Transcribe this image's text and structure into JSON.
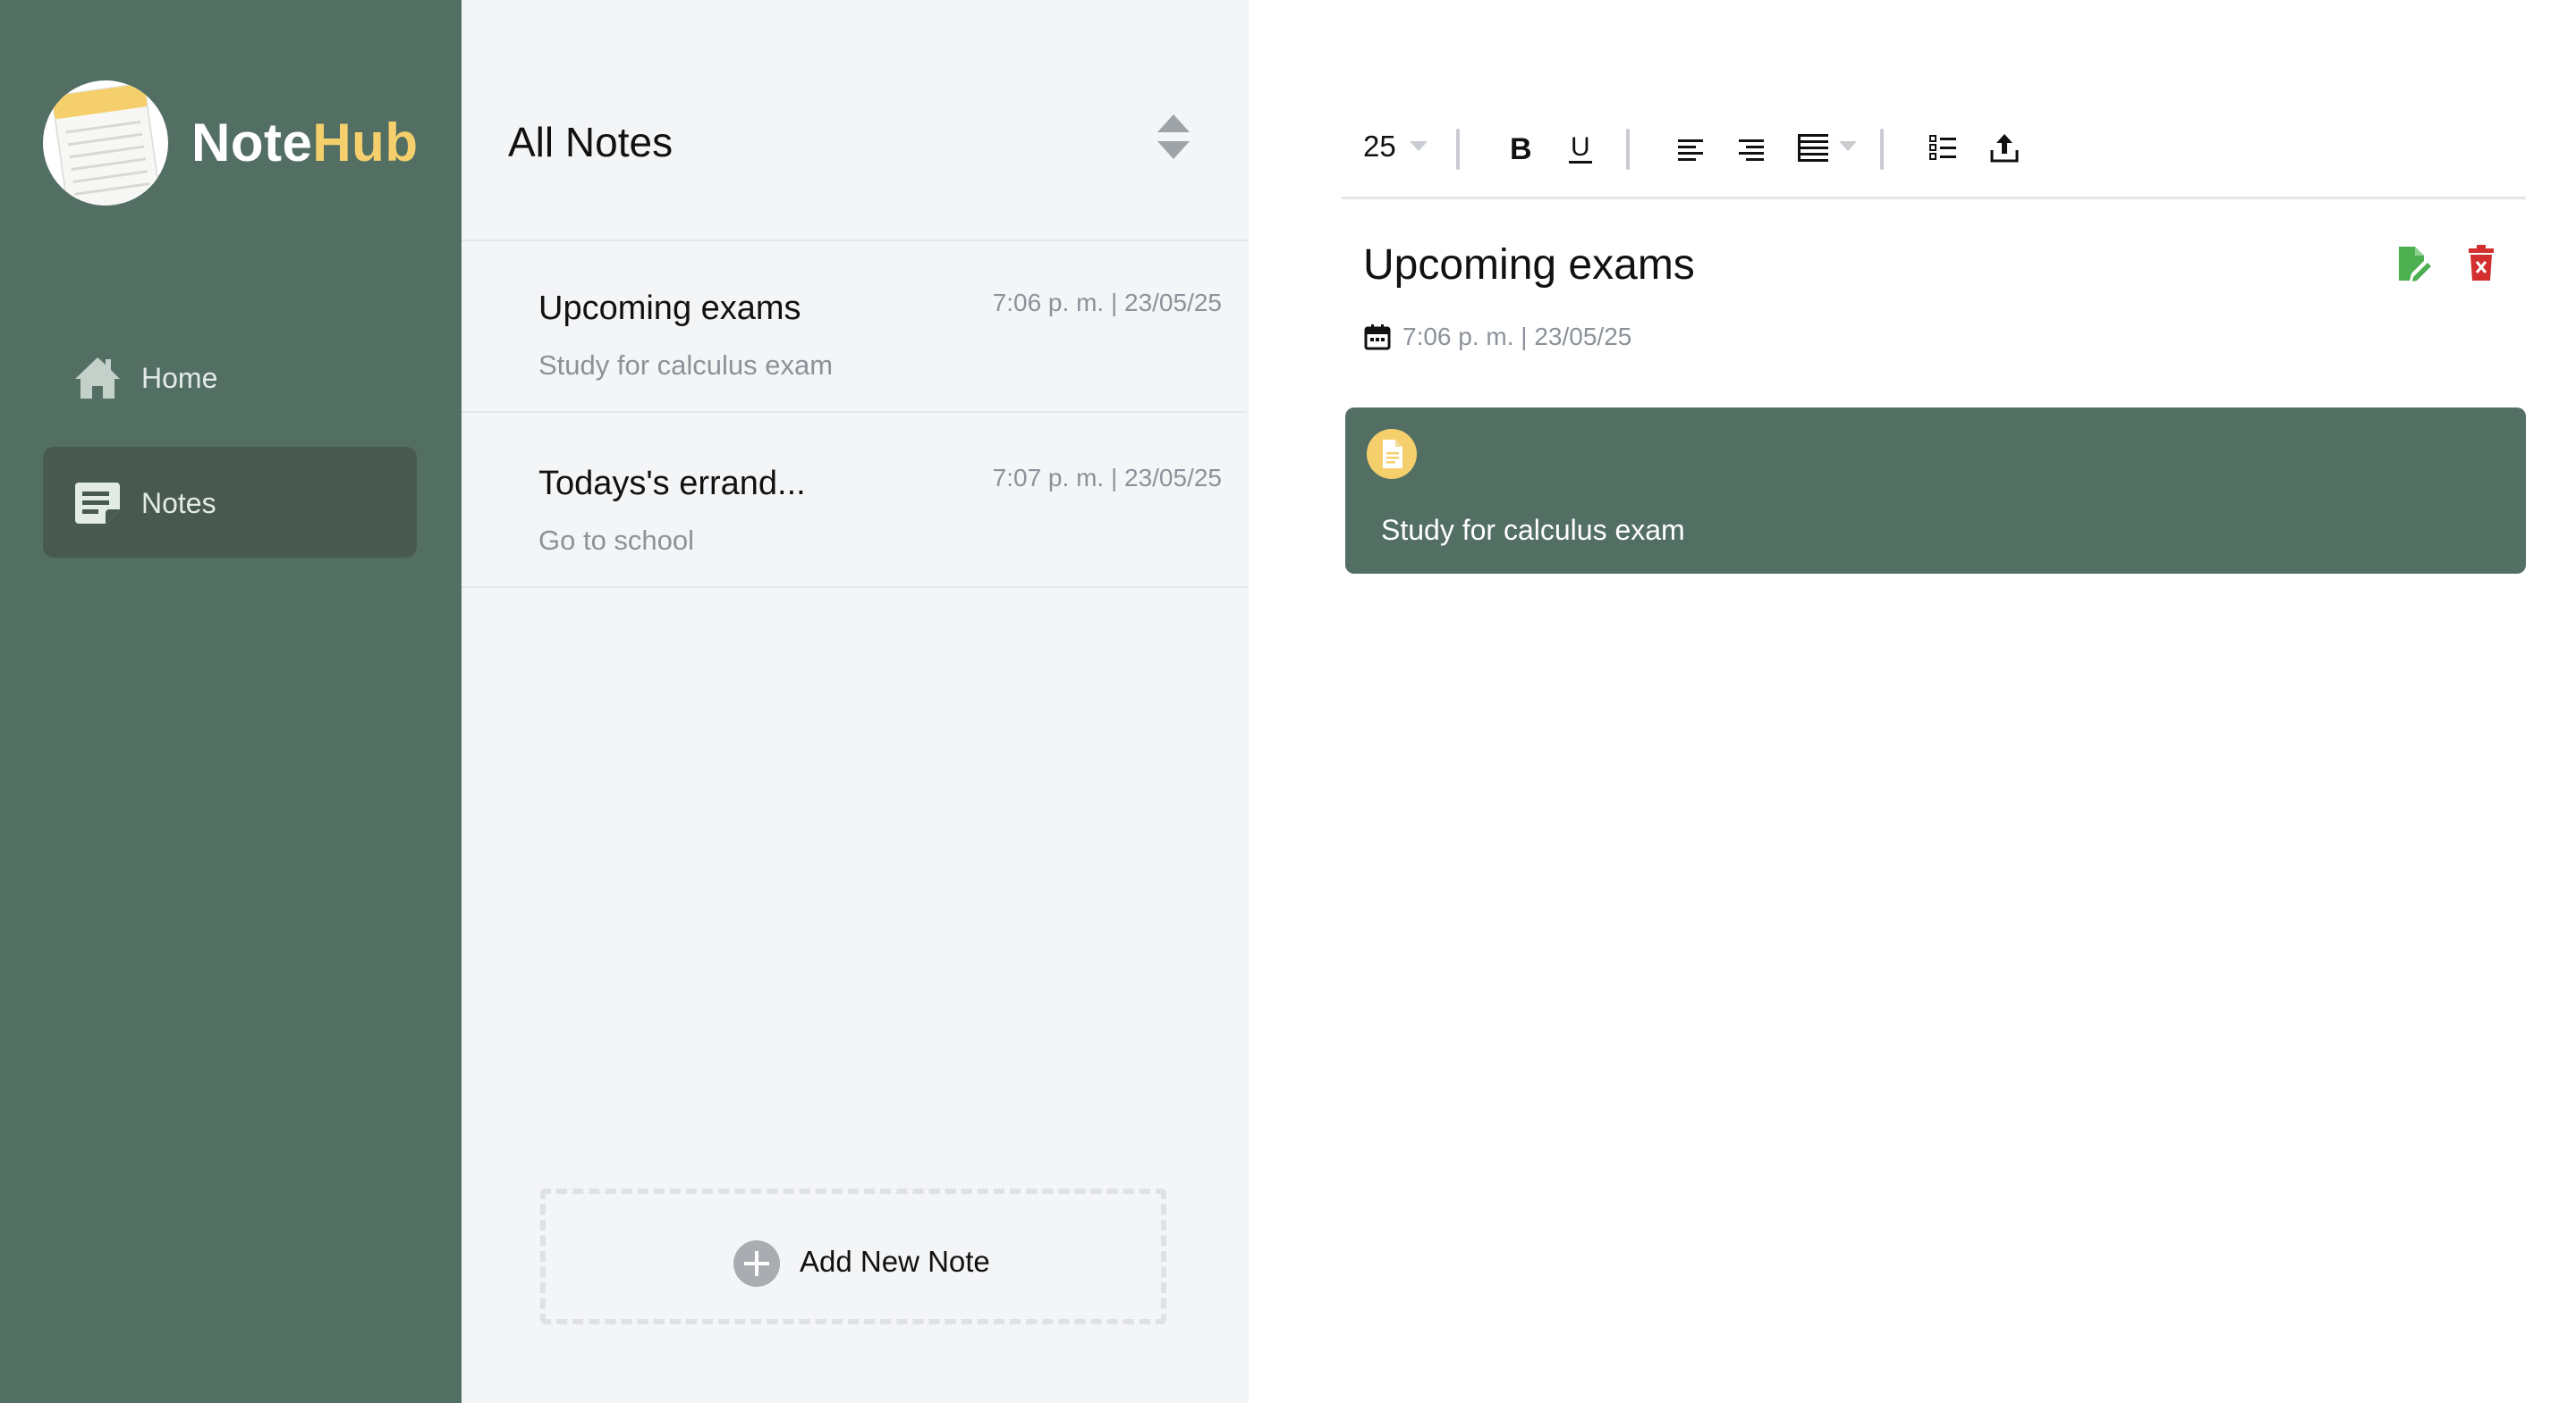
{
  "app": {
    "brand_part1": "Note",
    "brand_part2": "Hub"
  },
  "sidebar": {
    "items": [
      {
        "label": "Home",
        "icon": "home-icon",
        "active": false
      },
      {
        "label": "Notes",
        "icon": "notes-icon",
        "active": true
      }
    ]
  },
  "notes_list": {
    "title": "All Notes",
    "notes": [
      {
        "title": "Upcoming exams",
        "time": "7:06 p. m. | 23/05/25",
        "preview": "Study for calculus exam"
      },
      {
        "title": "Todays's errand...",
        "time": "7:07 p. m. | 23/05/25",
        "preview": "Go to school"
      }
    ],
    "add_label": "Add New Note"
  },
  "toolbar": {
    "font_size": "25",
    "buttons": [
      "bold-icon",
      "underline-icon",
      "align-left-icon",
      "align-right-icon",
      "align-justify-icon",
      "list-icon",
      "upload-icon"
    ]
  },
  "editor": {
    "title": "Upcoming exams",
    "timestamp": "7:06 p. m. | 23/05/25",
    "content": "Study for calculus exam"
  },
  "colors": {
    "sidebar_bg": "#536f64",
    "active_item_bg": "#48594f",
    "brand_accent": "#f5cf6b",
    "edit_green": "#4caf50",
    "delete_red": "#d32f2f"
  }
}
